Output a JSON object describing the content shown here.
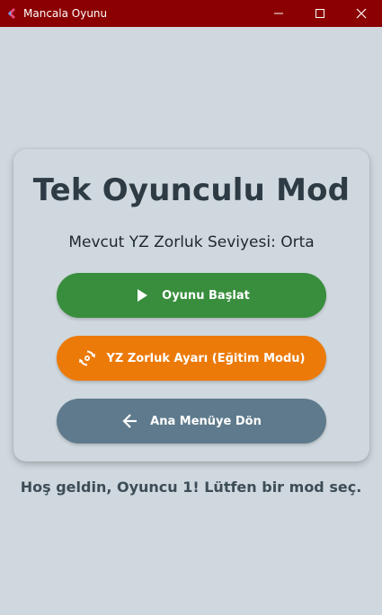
{
  "window": {
    "title": "Mancala Oyunu"
  },
  "card": {
    "title": "Tek Oyunculu Mod",
    "difficulty_text": "Mevcut YZ Zorluk Seviyesi: Orta"
  },
  "buttons": {
    "start_label": "Oyunu Başlat",
    "ai_difficulty_label": "YZ Zorluk Ayarı (Eğitim Modu)",
    "back_label": "Ana Menüye Dön"
  },
  "welcome_text": "Hoş geldin, Oyuncu 1! Lütfen bir mod seç.",
  "icons": {
    "app": "app-icon",
    "start": "play-icon",
    "ai": "refresh-settings-icon",
    "back": "arrow-left-icon"
  },
  "colors": {
    "titlebar": "#8b0000",
    "background": "#cfd8de",
    "start_button": "#388e3c",
    "ai_button": "#ec7a08",
    "back_button": "#5e7a8c"
  }
}
